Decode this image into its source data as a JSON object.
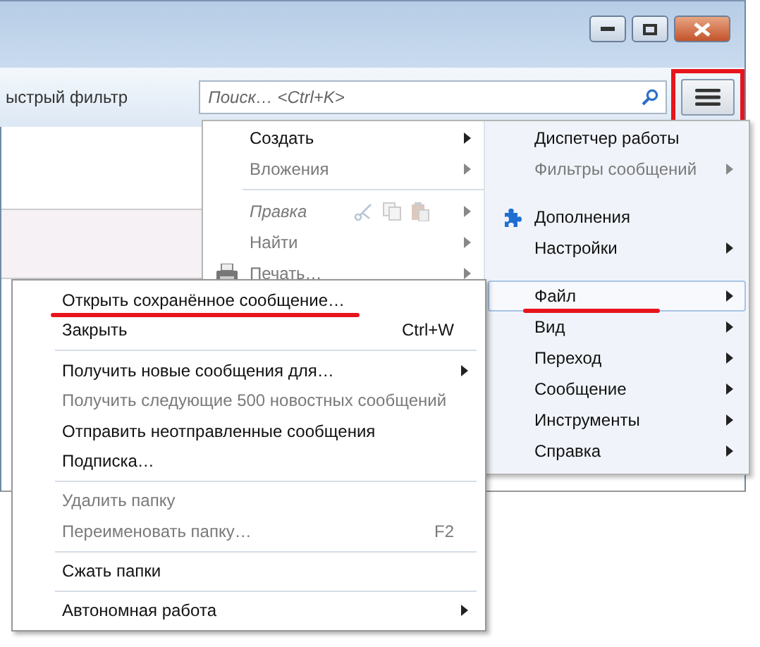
{
  "toolbar": {
    "filter_label": "ыстрый фильтр",
    "search": {
      "placeholder": "Поиск… <Ctrl+K>"
    },
    "menu_button": {
      "highlighted": true
    }
  },
  "app_menu": {
    "left": [
      {
        "kind": "item",
        "label": "Создать",
        "disabled": false,
        "submenu": true
      },
      {
        "kind": "item",
        "label": "Вложения",
        "disabled": true,
        "submenu": true
      },
      {
        "kind": "separator"
      },
      {
        "kind": "edit-row",
        "label": "Правка",
        "disabled": true,
        "submenu": true
      },
      {
        "kind": "item",
        "label": "Найти",
        "disabled": true,
        "submenu": true
      },
      {
        "kind": "item",
        "label": "Печать…",
        "disabled": true,
        "submenu": true
      }
    ],
    "right": [
      {
        "kind": "item",
        "label": "Диспетчер работы",
        "disabled": false,
        "submenu": false,
        "selected": false,
        "underlined": false
      },
      {
        "kind": "item",
        "label": "Фильтры сообщений",
        "disabled": true,
        "submenu": true,
        "selected": false,
        "underlined": false
      },
      {
        "kind": "gap"
      },
      {
        "kind": "item",
        "label": "Дополнения",
        "disabled": false,
        "submenu": false,
        "selected": false,
        "underlined": false
      },
      {
        "kind": "item",
        "label": "Настройки",
        "disabled": false,
        "submenu": true,
        "selected": false,
        "underlined": false
      },
      {
        "kind": "gap"
      },
      {
        "kind": "item",
        "label": "Файл",
        "disabled": false,
        "submenu": true,
        "selected": true,
        "underlined": true
      },
      {
        "kind": "item",
        "label": "Вид",
        "disabled": false,
        "submenu": true,
        "selected": false,
        "underlined": false
      },
      {
        "kind": "item",
        "label": "Переход",
        "disabled": false,
        "submenu": true,
        "selected": false,
        "underlined": false
      },
      {
        "kind": "item",
        "label": "Сообщение",
        "disabled": false,
        "submenu": true,
        "selected": false,
        "underlined": false
      },
      {
        "kind": "item",
        "label": "Инструменты",
        "disabled": false,
        "submenu": true,
        "selected": false,
        "underlined": false
      },
      {
        "kind": "item",
        "label": "Справка",
        "disabled": false,
        "submenu": true,
        "selected": false,
        "underlined": false
      }
    ]
  },
  "file_menu": [
    {
      "kind": "item",
      "label": "Открыть сохранённое сообщение…",
      "disabled": false,
      "submenu": false,
      "underlined": true
    },
    {
      "kind": "item",
      "label": "Закрыть",
      "shortcut": "Ctrl+W",
      "disabled": false,
      "submenu": false,
      "underlined": false
    },
    {
      "kind": "separator"
    },
    {
      "kind": "item",
      "label": "Получить новые сообщения для…",
      "disabled": false,
      "submenu": true,
      "underlined": false
    },
    {
      "kind": "item",
      "label": "Получить следующие 500 новостных сообщений",
      "disabled": true,
      "submenu": false,
      "underlined": false
    },
    {
      "kind": "item",
      "label": "Отправить неотправленные сообщения",
      "disabled": false,
      "submenu": false,
      "underlined": false
    },
    {
      "kind": "item",
      "label": "Подписка…",
      "disabled": false,
      "submenu": false,
      "underlined": false
    },
    {
      "kind": "separator"
    },
    {
      "kind": "item",
      "label": "Удалить папку",
      "disabled": true,
      "submenu": false,
      "underlined": false
    },
    {
      "kind": "item",
      "label": "Переименовать папку…",
      "shortcut": "F2",
      "disabled": true,
      "submenu": false,
      "underlined": false
    },
    {
      "kind": "separator"
    },
    {
      "kind": "item",
      "label": "Сжать папки",
      "disabled": false,
      "submenu": false,
      "underlined": false
    },
    {
      "kind": "separator"
    },
    {
      "kind": "item",
      "label": "Автономная работа",
      "disabled": false,
      "submenu": true,
      "underlined": false
    }
  ]
}
